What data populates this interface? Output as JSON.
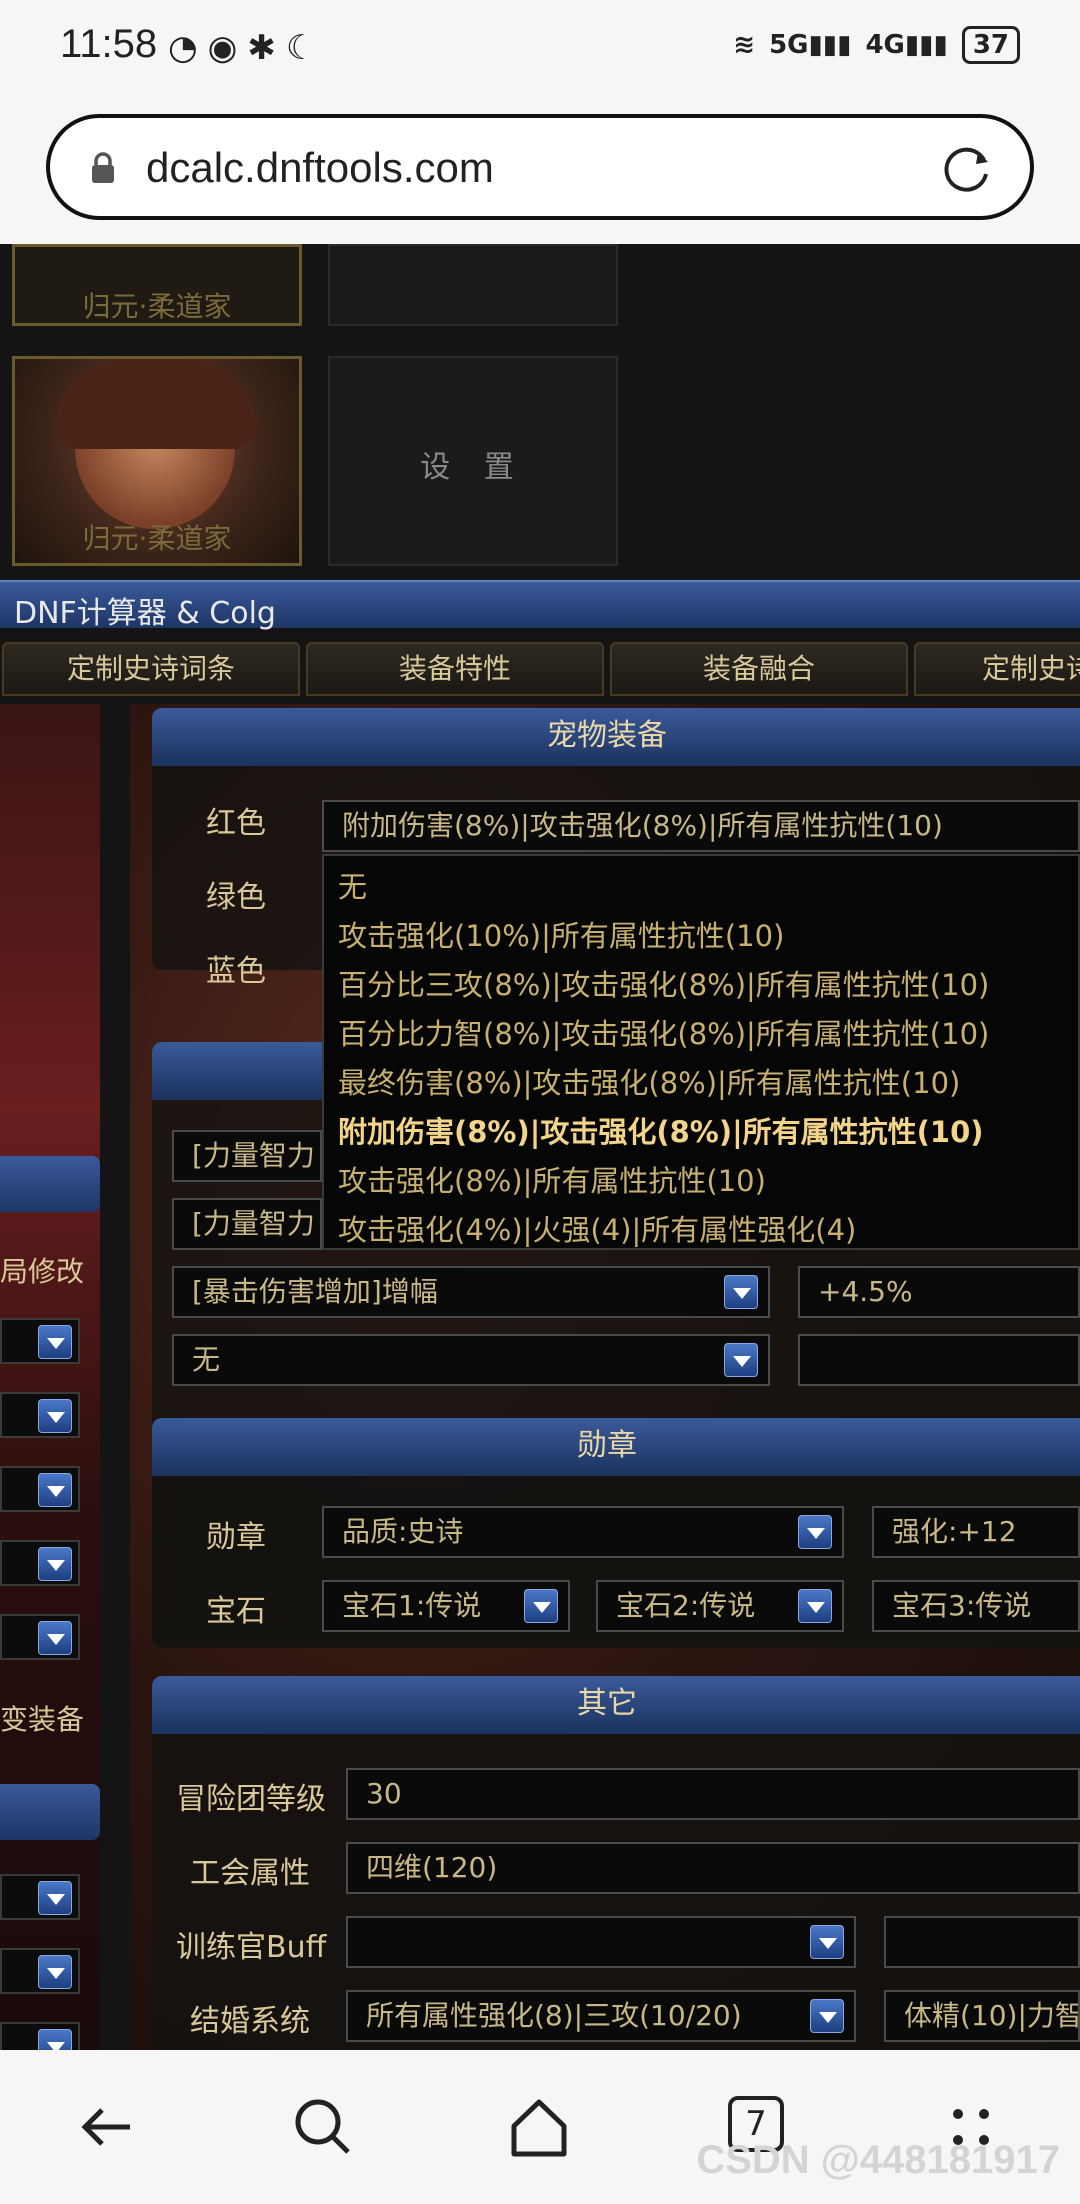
{
  "status_bar": {
    "time": "11:58",
    "battery": "37",
    "net1": "5G",
    "net2": "4G"
  },
  "browser": {
    "url": "dcalc.dnftools.com",
    "tab_count": "7"
  },
  "characters": {
    "top_label": "归元·柔道家",
    "card_label": "归元·柔道家",
    "settings_label": "设 置"
  },
  "app_title": "DNF计算器 & Colg",
  "tabs": [
    "定制史诗词条",
    "装备特性",
    "装备融合",
    "定制史诗"
  ],
  "left_panel": {
    "text1": "局修改",
    "text2": "变装备"
  },
  "pet": {
    "title": "宠物装备",
    "labels": {
      "red": "红色",
      "green": "绿色",
      "blue": "蓝色"
    },
    "red_value": "附加伤害(8%)|攻击强化(8%)|所有属性抗性(10)",
    "options": [
      "无",
      "攻击强化(10%)|所有属性抗性(10)",
      "百分比三攻(8%)|攻击强化(8%)|所有属性抗性(10)",
      "百分比力智(8%)|攻击强化(8%)|所有属性抗性(10)",
      "最终伤害(8%)|攻击强化(8%)|所有属性抗性(10)",
      "附加伤害(8%)|攻击强化(8%)|所有属性抗性(10)",
      "攻击强化(8%)|所有属性抗性(10)",
      "攻击强化(4%)|火强(4)|所有属性强化(4)"
    ]
  },
  "buff": {
    "row1": "[力量智力",
    "row2": "[力量智力",
    "row3": "[暴击伤害增加]增幅",
    "row3_value": "+4.5%",
    "row4": "无"
  },
  "medal": {
    "title": "勋章",
    "label_medal": "勋章",
    "label_gem": "宝石",
    "quality": "品质:史诗",
    "enhance": "强化:+12",
    "gem1": "宝石1:传说",
    "gem2": "宝石2:传说",
    "gem3": "宝石3:传说"
  },
  "other": {
    "title": "其它",
    "label_adventure": "冒险团等级",
    "adventure_value": "30",
    "label_guild": "工会属性",
    "guild_value": "四维(120)",
    "label_trainer": "训练官Buff",
    "trainer_value": "",
    "label_marriage": "结婚系统",
    "marriage_value": "所有属性强化(8)|三攻(10/20)",
    "marriage_extra": "体精(10)|力智"
  },
  "watermark": "CSDN @448181917"
}
